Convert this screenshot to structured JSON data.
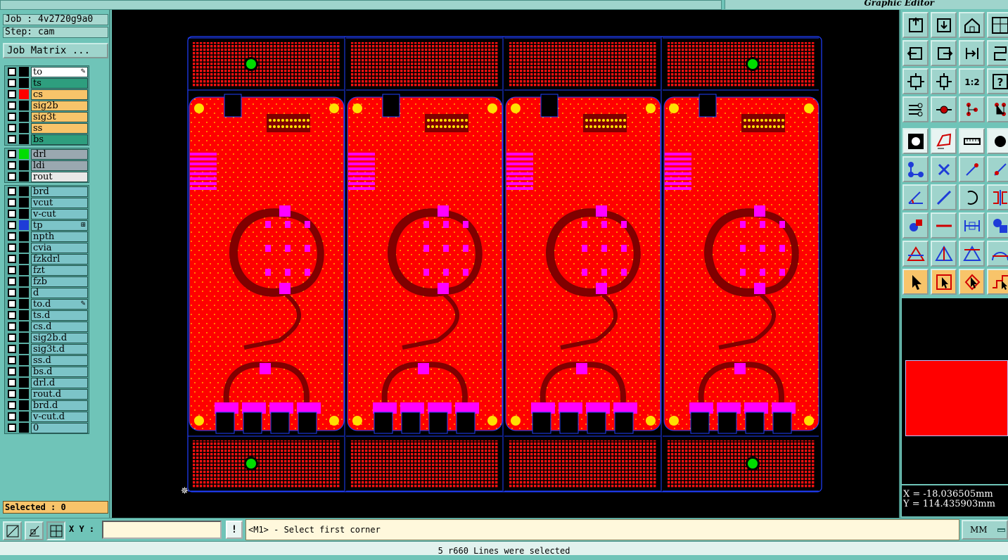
{
  "app": {
    "title": "Graphic Editor"
  },
  "job": {
    "job_label": "Job : 4v2720g9a0",
    "step_label": "Step: cam",
    "matrix_button": "Job Matrix ..."
  },
  "layer_groups": [
    [
      {
        "name": "to",
        "color": "#ffffff",
        "swatch": "#000000",
        "flag": "edit"
      },
      {
        "name": "ts",
        "color": "#2e9e7e",
        "swatch": "#000000"
      },
      {
        "name": "cs",
        "color": "#f8c46a",
        "swatch": "#ff0000"
      },
      {
        "name": "sig2b",
        "color": "#f8c46a",
        "swatch": "#000000"
      },
      {
        "name": "sig3t",
        "color": "#f8c46a",
        "swatch": "#000000"
      },
      {
        "name": "ss",
        "color": "#f8c46a",
        "swatch": "#000000"
      },
      {
        "name": "bs",
        "color": "#2e9e7e",
        "swatch": "#000000"
      }
    ],
    [
      {
        "name": "drl",
        "color": "#9aa8b0",
        "swatch": "#00dd00"
      },
      {
        "name": "ldi",
        "color": "#9aa8b0",
        "swatch": "#000000"
      },
      {
        "name": "rout",
        "color": "#e8e8e8",
        "swatch": "#000000"
      }
    ],
    [
      {
        "name": "brd",
        "color": "#7cc4c8",
        "swatch": "#000000"
      },
      {
        "name": "vcut",
        "color": "#7cc4c8",
        "swatch": "#000000"
      },
      {
        "name": "v-cut",
        "color": "#7cc4c8",
        "swatch": "#000000"
      },
      {
        "name": "tp",
        "color": "#7cc4c8",
        "swatch": "#1e3cd8",
        "flag": "sel"
      },
      {
        "name": "npth",
        "color": "#7cc4c8",
        "swatch": "#000000"
      },
      {
        "name": "cvia",
        "color": "#7cc4c8",
        "swatch": "#000000"
      },
      {
        "name": "fzkdrl",
        "color": "#7cc4c8",
        "swatch": "#000000"
      },
      {
        "name": "fzt",
        "color": "#7cc4c8",
        "swatch": "#000000"
      },
      {
        "name": "fzb",
        "color": "#7cc4c8",
        "swatch": "#000000"
      },
      {
        "name": "d",
        "color": "#7cc4c8",
        "swatch": "#000000"
      },
      {
        "name": "to.d",
        "color": "#7cc4c8",
        "swatch": "#000000",
        "flag": "edit"
      },
      {
        "name": "ts.d",
        "color": "#7cc4c8",
        "swatch": "#000000"
      },
      {
        "name": "cs.d",
        "color": "#7cc4c8",
        "swatch": "#000000"
      },
      {
        "name": "sig2b.d",
        "color": "#7cc4c8",
        "swatch": "#000000"
      },
      {
        "name": "sig3t.d",
        "color": "#7cc4c8",
        "swatch": "#000000"
      },
      {
        "name": "ss.d",
        "color": "#7cc4c8",
        "swatch": "#000000"
      },
      {
        "name": "bs.d",
        "color": "#7cc4c8",
        "swatch": "#000000"
      },
      {
        "name": "drl.d",
        "color": "#7cc4c8",
        "swatch": "#000000"
      },
      {
        "name": "rout.d",
        "color": "#7cc4c8",
        "swatch": "#000000"
      },
      {
        "name": "brd.d",
        "color": "#7cc4c8",
        "swatch": "#000000"
      },
      {
        "name": "v-cut.d",
        "color": "#7cc4c8",
        "swatch": "#000000"
      },
      {
        "name": "0",
        "color": "#7cc4c8",
        "swatch": "#000000"
      }
    ]
  ],
  "selection": {
    "label": "Selected : 0"
  },
  "canvas": {
    "board_count": 4,
    "colors": {
      "background": "#000000",
      "copper": "#ff0000",
      "pads": "#ff00ff",
      "traces": "#800000",
      "outline": "#2040ff",
      "holes": "#ffe000",
      "fiducial": "#00dd00"
    }
  },
  "toolbar": {
    "tools": [
      "zoom-home-icon",
      "zoom-page-icon",
      "house-icon",
      "window-split-icon",
      "pan-left-icon",
      "pan-right-icon",
      "zoom-back-icon",
      "redraw-icon",
      "fit-screen-icon",
      "fit-height-icon",
      "scale-1-to-1-icon",
      "help-icon",
      "tools-icon",
      "probe-icon",
      "net-highlight-icon",
      "net-compare-icon",
      "pad-icon",
      "polygon-icon",
      "ruler-icon",
      "dot-icon",
      "connect-icon",
      "cross-icon",
      "add-point-icon",
      "move-point-icon",
      "angle-icon",
      "line-icon",
      "arc-icon",
      "flip-icon",
      "shape-select-icon",
      "horizontal-line-icon",
      "dimension-icon",
      "group-icon",
      "triangle-icon",
      "triangle-outline-icon",
      "text-triangle-icon",
      "arch-icon",
      "pointer-icon",
      "select-box-icon",
      "select-pointer-icon",
      "route-select-icon"
    ],
    "scale_label": "1:2",
    "help_label": "?"
  },
  "coords": {
    "x": "X = -18.036505mm",
    "y": "Y = 114.435903mm"
  },
  "command": {
    "xy_label": "X Y :",
    "xy_value": "",
    "alert_label": "!",
    "prompt": "<M1> - Select first corner",
    "units": "MM"
  },
  "status": {
    "message": "5 r660 Lines were selected"
  }
}
